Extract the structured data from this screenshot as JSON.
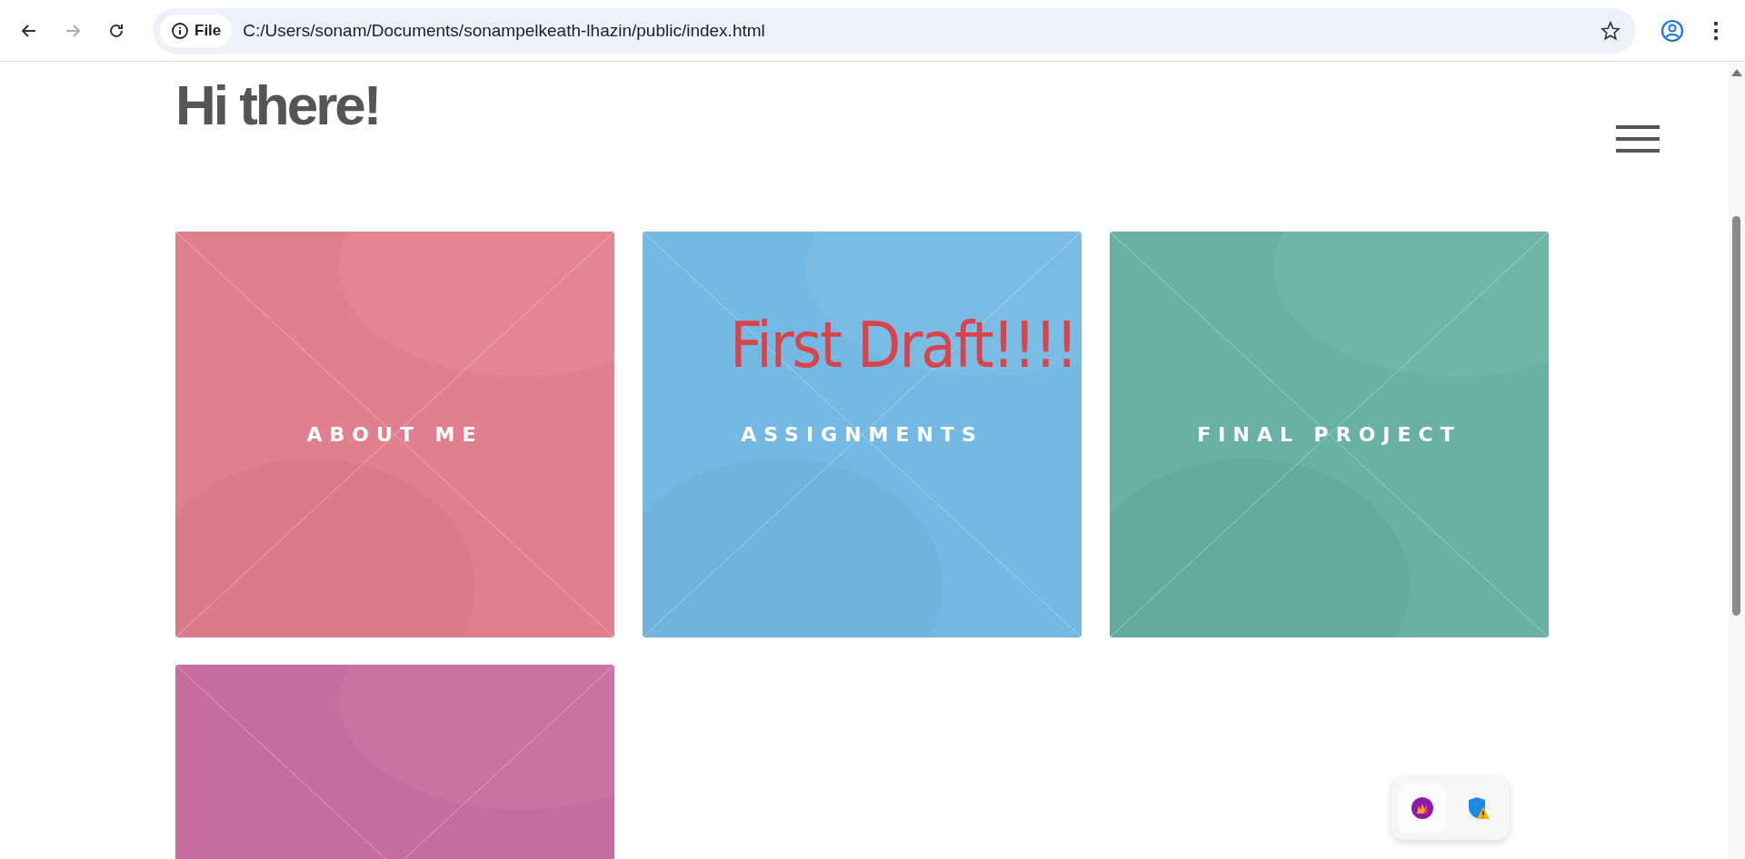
{
  "browser": {
    "security_label": "File",
    "url": "C:/Users/sonam/Documents/sonampelkeath-lhazin/public/index.html"
  },
  "page": {
    "heading": "Hi there!",
    "overlay_text": "First Draft!!!!",
    "cards": [
      {
        "label": "ABOUT ME",
        "color": "#e27f8e"
      },
      {
        "label": "ASSIGNMENTS",
        "color": "#74b9e4"
      },
      {
        "label": "FINAL PROJECT",
        "color": "#68b1a4"
      },
      {
        "color": "#c66c9e"
      }
    ]
  }
}
